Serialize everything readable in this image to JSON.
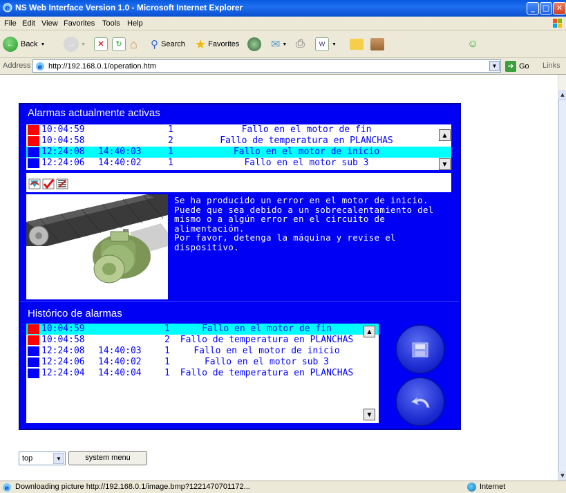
{
  "window": {
    "title": "NS Web Interface Version 1.0 - Microsoft Internet Explorer"
  },
  "menu": [
    "File",
    "Edit",
    "View",
    "Favorites",
    "Tools",
    "Help"
  ],
  "toolbar": {
    "back": "Back",
    "search": "Search",
    "favorites": "Favorites"
  },
  "address": {
    "label": "Address",
    "url": "http://192.168.0.1/operation.htm",
    "go": "Go",
    "links": "Links"
  },
  "active_alarms": {
    "title": "Alarmas actualmente activas",
    "rows": [
      {
        "t1": "10:04:59",
        "t2": "",
        "n": "1",
        "desc": "Fallo en el motor de fin",
        "color": "#ff0000",
        "selected": false
      },
      {
        "t1": "10:04:58",
        "t2": "",
        "n": "2",
        "desc": "Fallo de temperatura en PLANCHAS",
        "color": "#ff0000",
        "selected": false
      },
      {
        "t1": "12:24:08",
        "t2": "14:40:03",
        "n": "1",
        "desc": "Fallo en el motor de inicio",
        "color": "#0000ff",
        "selected": true
      },
      {
        "t1": "12:24:06",
        "t2": "14:40:02",
        "n": "1",
        "desc": "Fallo en el motor sub 3",
        "color": "#0000ff",
        "selected": false
      }
    ]
  },
  "detail": {
    "text_lines": [
      "Se ha producido un error en el motor de inicio.",
      "Puede que sea debido a un sobrecalentamiento del",
      "mismo o a algún error en el circuito de",
      "alimentación.",
      "Por favor, detenga la máquina y revise el",
      "dispositivo."
    ]
  },
  "history": {
    "title": "Histórico de alarmas",
    "rows": [
      {
        "t1": "10:04:59",
        "t2": "",
        "n": "1",
        "desc": "Fallo en el motor de fin",
        "color": "#ff0000",
        "selected": true
      },
      {
        "t1": "10:04:58",
        "t2": "",
        "n": "2",
        "desc": "Fallo de temperatura en PLANCHAS",
        "color": "#ff0000",
        "selected": false
      },
      {
        "t1": "12:24:08",
        "t2": "14:40:03",
        "n": "1",
        "desc": "Fallo en el motor de inicio",
        "color": "#0000ff",
        "selected": false
      },
      {
        "t1": "12:24:06",
        "t2": "14:40:02",
        "n": "1",
        "desc": "Fallo en el motor sub 3",
        "color": "#0000ff",
        "selected": false
      },
      {
        "t1": "12:24:04",
        "t2": "14:40:04",
        "n": "1",
        "desc": "Fallo de temperatura en PLANCHAS",
        "color": "#0000ff",
        "selected": false
      }
    ]
  },
  "bottom": {
    "frame_select": "top",
    "system_menu": "system menu"
  },
  "status": {
    "message": "Downloading picture http://192.168.0.1/image.bmp?1221470701172...",
    "zone": "Internet"
  },
  "colors": {
    "panel_bg": "#0000f4",
    "selected_row": "#00ffff",
    "alarm_active": "#ff0000",
    "alarm_cleared": "#0000ff"
  }
}
